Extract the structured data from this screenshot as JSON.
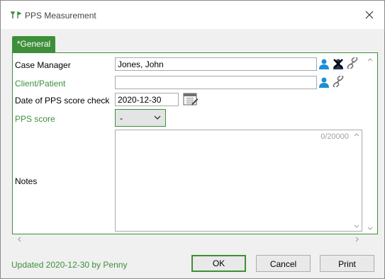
{
  "window": {
    "title": "PPS Measurement"
  },
  "tabs": [
    {
      "label": "*General"
    }
  ],
  "fields": {
    "case_manager": {
      "label": "Case Manager",
      "value": "Jones, John"
    },
    "client_patient": {
      "label": "Client/Patient",
      "value": ""
    },
    "date_check": {
      "label": "Date of PPS score check",
      "value": "2020-12-30"
    },
    "pps_score": {
      "label": "PPS score",
      "value": "-"
    },
    "notes": {
      "label": "Notes",
      "counter": "0/20000",
      "value": ""
    }
  },
  "footer": {
    "status": "Updated 2020-12-30 by Penny"
  },
  "buttons": {
    "ok": "OK",
    "cancel": "Cancel",
    "print": "Print"
  },
  "colors": {
    "accent": "#3d8f3a",
    "person_icon": "#1a8fd6",
    "link_icon": "#707070"
  },
  "icons": [
    "app-icon",
    "close-icon",
    "person-icon",
    "remove-icon",
    "link-icon",
    "calendar-icon",
    "chevron-down-icon"
  ]
}
